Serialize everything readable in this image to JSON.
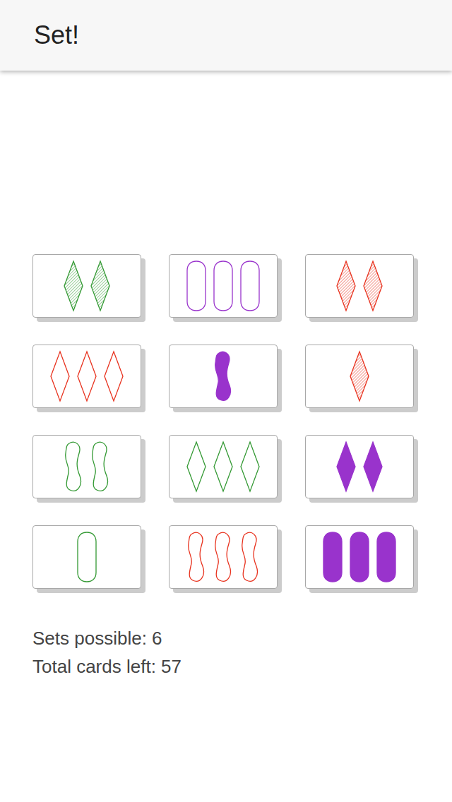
{
  "header": {
    "title": "Set!"
  },
  "cards": [
    {
      "count": 2,
      "color": "#339933",
      "shading": "striped",
      "shape": "diamond"
    },
    {
      "count": 3,
      "color": "#9933cc",
      "shading": "open",
      "shape": "oval"
    },
    {
      "count": 2,
      "color": "#e8321e",
      "shading": "striped",
      "shape": "diamond"
    },
    {
      "count": 3,
      "color": "#e8321e",
      "shading": "open",
      "shape": "diamond"
    },
    {
      "count": 1,
      "color": "#9933cc",
      "shading": "solid",
      "shape": "squiggle"
    },
    {
      "count": 1,
      "color": "#e8321e",
      "shading": "striped",
      "shape": "diamond"
    },
    {
      "count": 2,
      "color": "#339933",
      "shading": "open",
      "shape": "squiggle"
    },
    {
      "count": 3,
      "color": "#339933",
      "shading": "open",
      "shape": "diamond"
    },
    {
      "count": 2,
      "color": "#9933cc",
      "shading": "solid",
      "shape": "diamond"
    },
    {
      "count": 1,
      "color": "#339933",
      "shading": "open",
      "shape": "oval"
    },
    {
      "count": 3,
      "color": "#e8321e",
      "shading": "open",
      "shape": "squiggle"
    },
    {
      "count": 3,
      "color": "#9933cc",
      "shading": "solid",
      "shape": "oval"
    }
  ],
  "status": {
    "sets_possible": "Sets possible: 6",
    "cards_left": "Total cards left: 57"
  }
}
